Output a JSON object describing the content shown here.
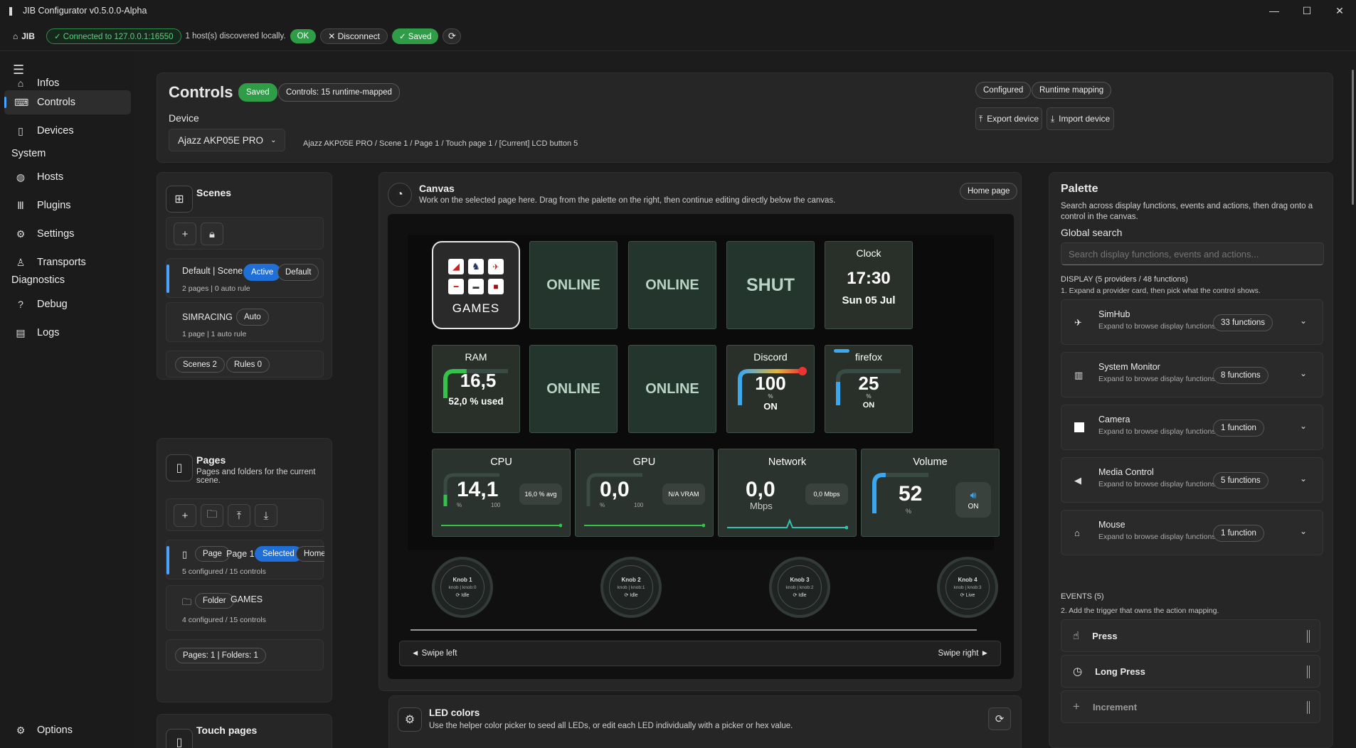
{
  "window": {
    "title": "JIB Configurator v0.5.0.0-Alpha",
    "minimize": "—",
    "maximize": "☐",
    "close": "✕"
  },
  "status": {
    "brand": "JIB",
    "connected": "✓ Connected to 127.0.0.1:16550",
    "discovered": "1 host(s) discovered locally.",
    "ok": "OK",
    "disconnect": "Disconnect",
    "saved": "✓ Saved"
  },
  "sidebar": {
    "items": [
      {
        "label": "Infos",
        "icon": "home-icon"
      },
      {
        "label": "Controls",
        "icon": "keyboard-icon"
      },
      {
        "label": "Devices",
        "icon": "device-icon"
      }
    ],
    "system_label": "System",
    "system_items": [
      {
        "label": "Hosts",
        "icon": "globe-icon"
      },
      {
        "label": "Plugins",
        "icon": "books-icon"
      },
      {
        "label": "Settings",
        "icon": "gear-icon"
      },
      {
        "label": "Transports",
        "icon": "person-icon"
      }
    ],
    "diag_label": "Diagnostics",
    "diag_items": [
      {
        "label": "Debug",
        "icon": "question-icon"
      },
      {
        "label": "Logs",
        "icon": "document-icon"
      }
    ],
    "options": "Options"
  },
  "header": {
    "title": "Controls",
    "saved": "Saved",
    "runtime_chip": "Controls: 15 runtime-mapped",
    "device_label": "Device",
    "device_value": "Ajazz AKP05E PRO",
    "breadcrumb": "Ajazz AKP05E PRO / Scene 1 / Page 1 / Touch page 1 / [Current] LCD button 5",
    "configured": "Configured",
    "runtime_mapping": "Runtime mapping",
    "export": "Export device",
    "import": "Import device"
  },
  "scenes": {
    "title": "Scenes",
    "scene1_name": "Default | Scene 1",
    "scene1_active": "Active",
    "scene1_default": "Default",
    "scene1_meta": "2 pages  |  0 auto rule",
    "scene2_name": "SIMRACING",
    "scene2_auto": "Auto",
    "scene2_meta": "1 page  |  1 auto rule",
    "count_scenes": "Scenes 2",
    "count_rules": "Rules 0"
  },
  "pages": {
    "title": "Pages",
    "desc": "Pages and folders for the current scene.",
    "page_type": "Page",
    "page_name": "Page 1",
    "page_selected": "Selected",
    "page_home": "Home",
    "page_meta": "5 configured / 15 controls",
    "folder_type": "Folder",
    "folder_name": "GAMES",
    "folder_meta": "4 configured / 15 controls",
    "count": "Pages: 1  |  Folders: 1",
    "touch_title": "Touch pages"
  },
  "canvas": {
    "title": "Canvas",
    "desc": "Work on the selected page here. Drag from the palette on the right, then continue editing directly below the canvas.",
    "home_page": "Home page",
    "games_label": "GAMES",
    "online": "ONLINE",
    "shut": "SHUT",
    "clock_label": "Clock",
    "clock_time": "17:30",
    "clock_date": "Sun 05 Jul",
    "ram_label": "RAM",
    "ram_value": "16,5",
    "ram_sub": "52,0 % used",
    "discord_label": "Discord",
    "discord_value": "100",
    "discord_unit": "%",
    "discord_state": "ON",
    "firefox_label": "firefox",
    "firefox_value": "25",
    "firefox_unit": "%",
    "firefox_state": "ON",
    "cpu_label": "CPU",
    "cpu_value": "14,1",
    "cpu_unit": "%",
    "cpu_max": "100",
    "cpu_side": "16,0 % avg",
    "gpu_label": "GPU",
    "gpu_value": "0,0",
    "gpu_unit": "%",
    "gpu_max": "100",
    "gpu_side": "N/A VRAM",
    "net_label": "Network",
    "net_value": "0,0",
    "net_unit": "Mbps",
    "net_side": "0,0 Mbps",
    "vol_label": "Volume",
    "vol_value": "52",
    "vol_unit": "%",
    "vol_state": "ON",
    "knobs": [
      {
        "name": "Knob 1",
        "id": "knob | knob:0",
        "state": "Idle"
      },
      {
        "name": "Knob 2",
        "id": "knob | knob:1",
        "state": "Idle"
      },
      {
        "name": "Knob 3",
        "id": "knob | knob:2",
        "state": "Idle"
      },
      {
        "name": "Knob 4",
        "id": "knob | knob:3",
        "state": "Live"
      }
    ],
    "swipe_left": "◄ Swipe left",
    "swipe_right": "Swipe right ►",
    "levels": {
      "ram": 0.52,
      "discord": 1.0,
      "firefox": 0.25,
      "cpu": 0.141,
      "gpu": 0.0,
      "vol": 0.52
    }
  },
  "led": {
    "title": "LED colors",
    "desc": "Use the helper color picker to seed all LEDs, or edit each LED individually with a picker or hex value."
  },
  "palette": {
    "title": "Palette",
    "desc": "Search across display functions, events and actions, then drag onto a control in the canvas.",
    "search_label": "Global search",
    "search_placeholder": "Search display functions, events and actions...",
    "display_header": "DISPLAY (5 providers / 48 functions)",
    "display_hint": "1. Expand a provider card, then pick what the control shows.",
    "providers": [
      {
        "name": "SimHub",
        "desc": "Expand to browse display functions",
        "count": "33 functions"
      },
      {
        "name": "System Monitor",
        "desc": "Expand to browse display functions",
        "count": "8 functions"
      },
      {
        "name": "Camera",
        "desc": "Expand to browse display functions",
        "count": "1 function"
      },
      {
        "name": "Media Control",
        "desc": "Expand to browse display functions",
        "count": "5 functions"
      },
      {
        "name": "Mouse",
        "desc": "Expand to browse display functions",
        "count": "1 function"
      }
    ],
    "events_header": "EVENTS (5)",
    "events_hint": "2. Add the trigger that owns the action mapping.",
    "events": [
      {
        "name": "Press"
      },
      {
        "name": "Long Press"
      },
      {
        "name": "Increment"
      }
    ]
  },
  "colors": {
    "accent": "#1f6fd6",
    "success": "#2f9d47",
    "lcd_tile": "#24352d"
  }
}
